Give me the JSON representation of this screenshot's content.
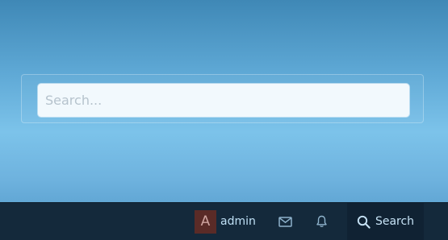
{
  "search": {
    "value": "",
    "placeholder": "Search..."
  },
  "navbar": {
    "account": {
      "avatar_letter": "A",
      "username": "admin",
      "avatar_color": "#5a2b27"
    },
    "inbox": {
      "icon": "envelope-icon"
    },
    "alerts": {
      "icon": "bell-icon"
    },
    "search_button": {
      "icon": "magnifier-icon",
      "label": "Search"
    }
  },
  "colors": {
    "background_top": "#3f88b6",
    "background_mid": "#7cc3ea",
    "navbar": "#14293b",
    "link_text": "#bfe0f5"
  }
}
